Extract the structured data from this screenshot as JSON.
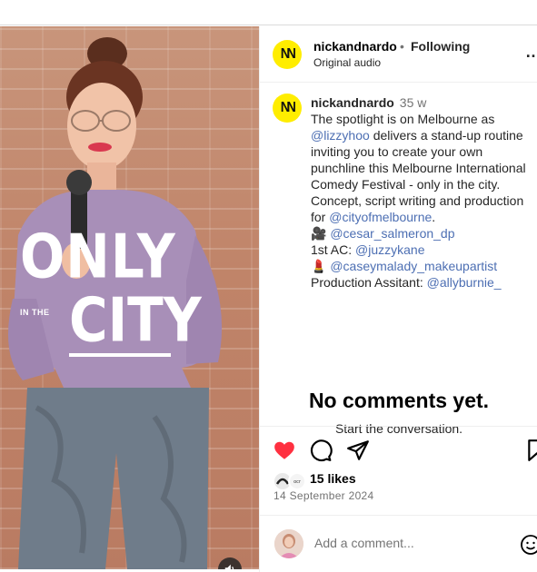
{
  "post": {
    "username": "nickandnardo",
    "separator": "•",
    "follow_status": "Following",
    "audio": "Original audio",
    "avatar_text": "NN",
    "overlay": {
      "word_top": "ONLY",
      "word_small": "IN THE",
      "word_bottom": "CITY"
    }
  },
  "caption": {
    "username": "nickandnardo",
    "age": "35 w",
    "lines": [
      "The spotlight is on Melbourne as",
      "delivers a stand-up routine",
      "inviting you to create your own",
      "punchline this Melbourne International",
      "Comedy Festival - only in the city.",
      "Concept, script writing and production",
      "for"
    ],
    "mention_lizzyhoo": "@lizzyhoo",
    "mention_city": "@cityofmelbourne",
    "period": ".",
    "credit_camera_emoji": "🎥",
    "mention_cesar": "@cesar_salmeron_dp",
    "ac_label": "1st AC:",
    "mention_juzzy": "@juzzykane",
    "credit_lipstick_emoji": "💄",
    "mention_casey": "@caseymalady_makeupartist",
    "pa_label": "Production Assitant:",
    "mention_ally": "@allyburnie_"
  },
  "comments": {
    "empty_title": "No comments yet.",
    "empty_subtitle": "Start the conversation."
  },
  "engagement": {
    "likes": "15 likes",
    "date": "14 September 2024",
    "liker_badge": "ocr"
  },
  "composer": {
    "placeholder": "Add a comment..."
  },
  "colors": {
    "like_red": "#ff3040",
    "mention_blue": "#4d6fb3",
    "avatar_yellow": "#ffed00"
  }
}
